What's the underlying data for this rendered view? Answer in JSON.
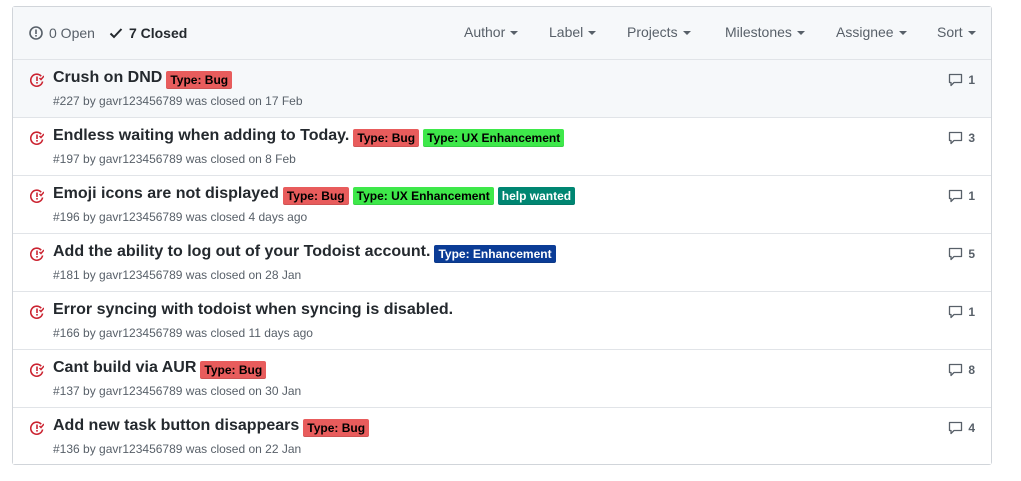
{
  "header": {
    "open_label": "0 Open",
    "closed_label": "7 Closed",
    "filters": [
      {
        "label": "Author",
        "name": "filter-author"
      },
      {
        "label": "Label",
        "name": "filter-label"
      },
      {
        "label": "Projects",
        "name": "filter-projects"
      },
      {
        "label": "Milestones",
        "name": "filter-milestones"
      },
      {
        "label": "Assignee",
        "name": "filter-assignee"
      },
      {
        "label": "Sort",
        "name": "filter-sort"
      }
    ]
  },
  "issues": [
    {
      "title": "Crush on DND",
      "meta": "#227 by gavr123456789 was closed on 17 Feb",
      "comments": "1",
      "labels": [
        {
          "text": "Type: Bug",
          "bg": "#e85c5c",
          "fg": "#000000"
        }
      ]
    },
    {
      "title": "Endless waiting when adding to Today.",
      "meta": "#197 by gavr123456789 was closed on 8 Feb",
      "comments": "3",
      "labels": [
        {
          "text": "Type: Bug",
          "bg": "#e85c5c",
          "fg": "#000000"
        },
        {
          "text": "Type: UX Enhancement",
          "bg": "#3ee84a",
          "fg": "#000000"
        }
      ]
    },
    {
      "title": "Emoji icons are not displayed",
      "meta": "#196 by gavr123456789 was closed 4 days ago",
      "comments": "1",
      "labels": [
        {
          "text": "Type: Bug",
          "bg": "#e85c5c",
          "fg": "#000000"
        },
        {
          "text": "Type: UX Enhancement",
          "bg": "#3ee84a",
          "fg": "#000000"
        },
        {
          "text": "help wanted",
          "bg": "#008672",
          "fg": "#ffffff"
        }
      ]
    },
    {
      "title": "Add the ability to log out of your Todoist account.",
      "meta": "#181 by gavr123456789 was closed on 28 Jan",
      "comments": "5",
      "labels": [
        {
          "text": "Type: Enhancement",
          "bg": "#0b3c96",
          "fg": "#ffffff"
        }
      ]
    },
    {
      "title": "Error syncing with todoist when syncing is disabled.",
      "meta": "#166 by gavr123456789 was closed 11 days ago",
      "comments": "1",
      "labels": []
    },
    {
      "title": "Cant build via AUR",
      "meta": "#137 by gavr123456789 was closed on 30 Jan",
      "comments": "8",
      "labels": [
        {
          "text": "Type: Bug",
          "bg": "#e85c5c",
          "fg": "#000000"
        }
      ]
    },
    {
      "title": "Add new task button disappears",
      "meta": "#136 by gavr123456789 was closed on 22 Jan",
      "comments": "4",
      "labels": [
        {
          "text": "Type: Bug",
          "bg": "#e85c5c",
          "fg": "#000000"
        }
      ]
    }
  ],
  "colors": {
    "closed_icon": "#cb2431",
    "muted": "#586069",
    "border": "#e1e4e8"
  }
}
